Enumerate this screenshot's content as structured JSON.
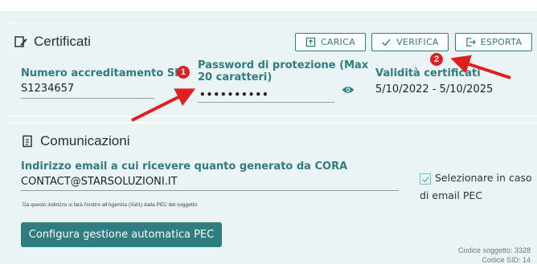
{
  "certificati": {
    "title": "Certificati",
    "buttons": {
      "carica": "CARICA",
      "verifica": "VERIFICA",
      "esporta": "ESPORTA"
    },
    "sid_label": "Numero accreditamento SID",
    "sid_value": "S1234657",
    "password_label_line1": "Password di protezione (Max",
    "password_label_line2": "20 caratteri)",
    "password_value": "••••••••••",
    "validity_label": "Validità certificati",
    "validity_value": "5/10/2022 - 5/10/2025"
  },
  "comunicazioni": {
    "title": "Comunicazioni",
    "email_label": "Indirizzo email a cui ricevere quanto generato da CORA",
    "email_value": "CONTACT@STARSOLUZIONI.IT",
    "checkbox_line1": "Selezionare in caso",
    "checkbox_line2": "di email PEC",
    "checkbox_checked": true,
    "note": "Da questo indirizzo si farà l'inoltro all'Agenzia (Sid1) dalla PEC del soggetto",
    "pec_button": "Configura gestione automatica PEC",
    "codice_soggetto": "Codice soggetto: 3328",
    "codice_sid": "Codice SID: 14"
  },
  "annotations": {
    "badge1": "1",
    "badge2": "2",
    "color": "#e02020"
  },
  "colors": {
    "accent": "#2f7d80",
    "panel": "#eaf4f4"
  }
}
